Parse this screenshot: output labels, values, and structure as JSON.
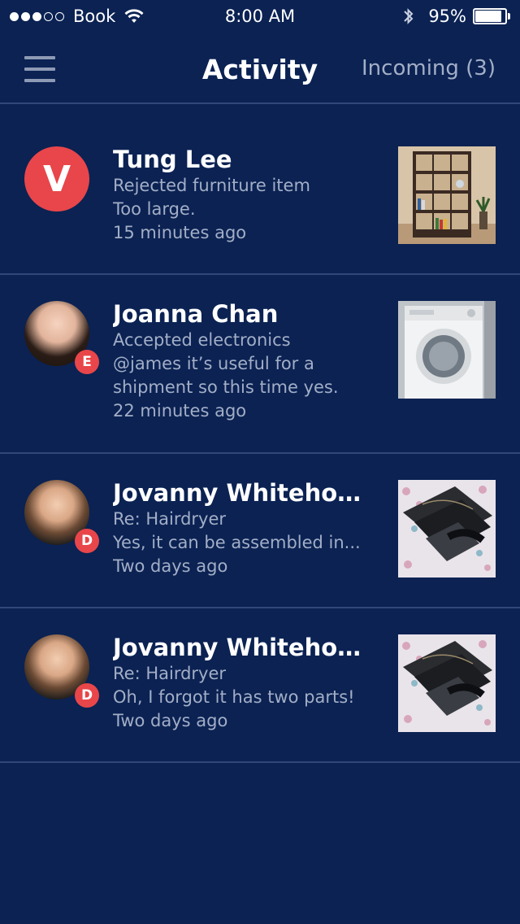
{
  "status_bar": {
    "signal_bars_full": 3,
    "signal_bars_total": 5,
    "carrier": "Book",
    "time": "8:00 AM",
    "battery_percent_text": "95%",
    "battery_level": 0.95
  },
  "nav": {
    "menu_icon": "hamburger-menu-icon",
    "title": "Activity",
    "incoming": "Incoming (3)"
  },
  "colors": {
    "background": "#0b2253",
    "divider": "#31477a",
    "accent_red": "#e8464a",
    "secondary_text": "#a3aec6"
  },
  "feed": [
    {
      "name": "Tung Lee",
      "avatar_letter": "V",
      "badge": "",
      "lines": [
        "Rejected furniture item",
        "Too large.",
        "15 minutes ago"
      ],
      "thumbnail": "bookshelf-thumbnail"
    },
    {
      "name": "Joanna Chan",
      "avatar_letter": "",
      "badge": "E",
      "lines": [
        "Accepted electronics",
        "@james it’s useful for a",
        "shipment so this time yes.",
        "22 minutes ago"
      ],
      "thumbnail": "washing-machine-thumbnail"
    },
    {
      "name": "Jovanny Whitehouse",
      "avatar_letter": "",
      "badge": "D",
      "lines": [
        "Re: Hairdryer",
        "Yes, it can be assembled in...",
        "Two days ago"
      ],
      "thumbnail": "hairdryer-thumbnail"
    },
    {
      "name": "Jovanny Whitehouse",
      "avatar_letter": "",
      "badge": "D",
      "lines": [
        "Re: Hairdryer",
        "Oh, I forgot it has two parts!",
        "Two days ago"
      ],
      "thumbnail": "hairdryer-thumbnail"
    }
  ]
}
